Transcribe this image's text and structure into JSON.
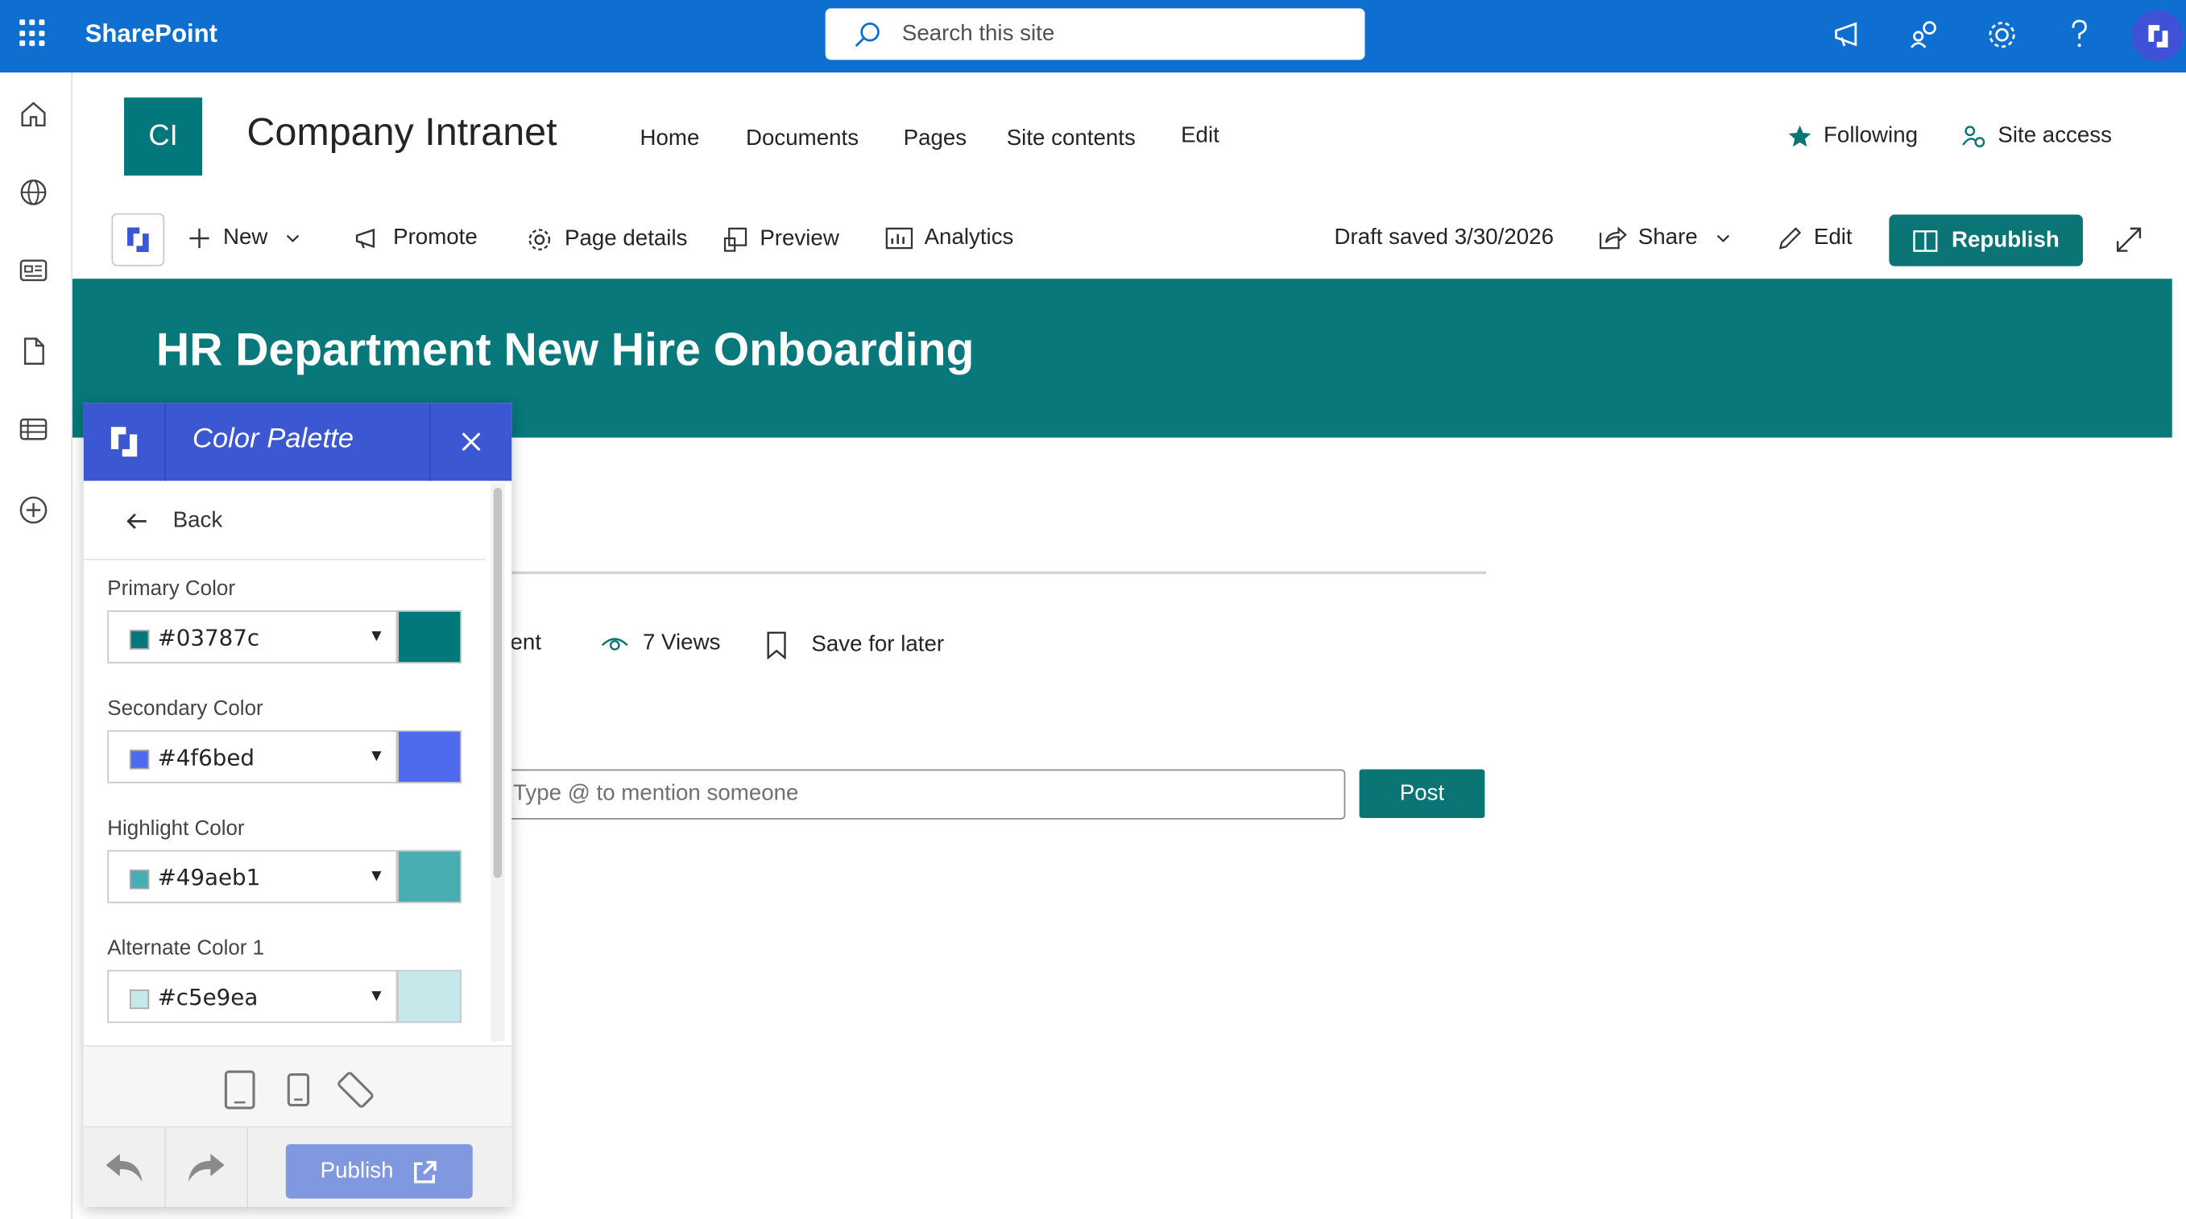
{
  "suite": {
    "app_name": "SharePoint",
    "search_placeholder": "Search this site"
  },
  "site": {
    "logo_initials": "CI",
    "title": "Company Intranet",
    "nav": [
      "Home",
      "Documents",
      "Pages",
      "Site contents",
      "Edit"
    ],
    "following_label": "Following",
    "site_access_label": "Site access"
  },
  "commandbar": {
    "new_label": "New",
    "promote_label": "Promote",
    "page_details_label": "Page details",
    "preview_label": "Preview",
    "analytics_label": "Analytics",
    "draft_status": "Draft saved 3/30/2026",
    "share_label": "Share",
    "edit_label": "Edit",
    "republish_label": "Republish"
  },
  "page": {
    "banner_title": "HR Department New Hire Onboarding",
    "partial_comment_label": "ent",
    "views_label": "7 Views",
    "save_label": "Save for later",
    "comment_placeholder": "Type @ to mention someone",
    "post_label": "Post"
  },
  "palette_panel": {
    "title": "Color Palette",
    "back_label": "Back",
    "colors": [
      {
        "label": "Primary Color",
        "value": "#03787c"
      },
      {
        "label": "Secondary Color",
        "value": "#4f6bed"
      },
      {
        "label": "Highlight Color",
        "value": "#49aeb1"
      },
      {
        "label": "Alternate Color 1",
        "value": "#c5e9ea"
      }
    ],
    "publish_label": "Publish"
  },
  "colors": {
    "suite_bar": "#0f6fd0",
    "theme_primary": "#03787c",
    "panel_header": "#3b57d1"
  }
}
